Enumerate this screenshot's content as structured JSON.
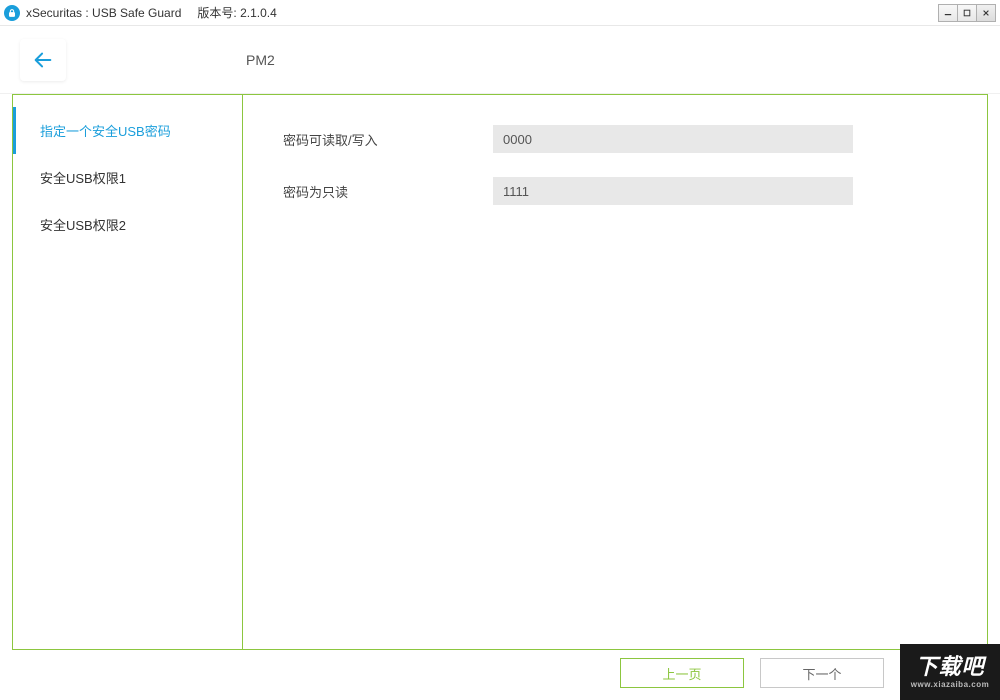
{
  "window": {
    "title": "xSecuritas : USB Safe Guard",
    "version_label": "版本号: 2.1.0.4"
  },
  "header": {
    "title": "PM2"
  },
  "sidebar": {
    "items": [
      {
        "label": "指定一个安全USB密码",
        "active": true
      },
      {
        "label": "安全USB权限1",
        "active": false
      },
      {
        "label": "安全USB权限2",
        "active": false
      }
    ]
  },
  "form": {
    "field_rw": {
      "label": "密码可读取/写入",
      "value": "0000"
    },
    "field_ro": {
      "label": "密码为只读",
      "value": "1111"
    }
  },
  "footer": {
    "prev": "上一页",
    "next": "下一个"
  },
  "watermark": {
    "text": "下载吧",
    "url": "www.xiazaiba.com"
  }
}
